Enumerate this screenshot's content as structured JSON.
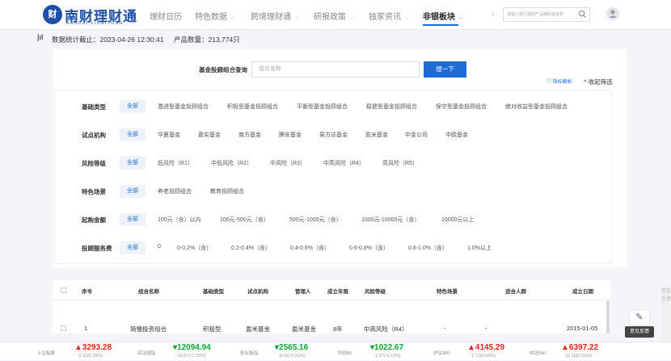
{
  "header": {
    "logo_glyph": "财",
    "brand": "南财理财通",
    "brand_sub": "NANCAI LICAITONG",
    "nav": [
      {
        "label": "理财日历",
        "chevron": false
      },
      {
        "label": "特色数据",
        "chevron": true
      },
      {
        "label": "跨境理财通",
        "chevron": true
      },
      {
        "label": "研报政策",
        "chevron": true
      },
      {
        "label": "独家资讯",
        "chevron": true
      },
      {
        "label": "非银板块",
        "chevron": true,
        "active": true
      }
    ],
    "nav_more_icon": "chevron-right-icon",
    "search_placeholder": "请输入银行理财产品编码或名称",
    "search_icon": "search-icon",
    "user_icon": "avatar-icon"
  },
  "stats": {
    "icon": "bar-chart-icon",
    "time_text": "数据统计截止：2023-04-26 12:30:41",
    "count_text": "产品数量：213,774只"
  },
  "query": {
    "label": "基金投顾组合查询",
    "placeholder": "组合名称",
    "button": "搜一下",
    "help_label": "指标解析",
    "collapse_label": "收起筛选"
  },
  "filters": [
    {
      "name": "基础类型",
      "all": "全部",
      "options": [
        "激进型基金投顾组合",
        "积极型基金投顾组合",
        "平衡型基金投顾组合",
        "稳健型基金投顾组合",
        "保守型基金投顾组合",
        "绝对收益型基金投顾组合"
      ]
    },
    {
      "name": "试点机构",
      "all": "全部",
      "options": [
        "华夏基金",
        "嘉实基金",
        "南方基金",
        "腾安基金",
        "易方达基金",
        "盈米基金",
        "中金公司",
        "中欧基金"
      ]
    },
    {
      "name": "风险等级",
      "all": "全部",
      "options": [
        "低风险（R1）",
        "中低风险（R2）",
        "中风险（R3）",
        "中高风险（R4）",
        "高风险（R5）"
      ]
    },
    {
      "name": "特色场景",
      "all": "全部",
      "options": [
        "养老投顾组合",
        "教育投顾组合"
      ]
    },
    {
      "name": "起购金额",
      "all": "全部",
      "options": [
        "100元（含）以内",
        "100元-500元（含）",
        "500元-1000元（含）",
        "1000元-10000元（含）",
        "10000元以上"
      ]
    },
    {
      "name": "投顾服务费",
      "all": "全部",
      "options": [
        "0",
        "0-0.2%（含）",
        "0.2-0.4%（含）",
        "0.4-0.6%（含）",
        "0.6-0.8%（含）",
        "0.8-1.0%（含）",
        "1.0%以上"
      ]
    }
  ],
  "table": {
    "headers": [
      "序号",
      "组合名称",
      "基础类型",
      "试点机构",
      "管理人",
      "成立年限",
      "风险等级",
      "特色场景",
      "适合人群",
      "成立日期"
    ],
    "rows": [
      [
        "1",
        "简慢投资组合",
        "积极型",
        "盈米基金",
        "盈米基金",
        "8年",
        "中高风险（R4）",
        "-",
        "-",
        "2015-01-05"
      ]
    ]
  },
  "feedback": {
    "icon": "edit-icon",
    "label": "意见反馈"
  },
  "side_tab": "意见反馈",
  "ticker": [
    {
      "name": "上证指数",
      "value": "3293.28",
      "change": "9.12(0.28%)",
      "dir": "up"
    },
    {
      "name": "深证成指",
      "value": "12094.94",
      "change": "-18.67(-0.15%)",
      "dir": "down"
    },
    {
      "name": "创业板指",
      "value": "2565.16",
      "change": "-8.02(-0.31%)",
      "dir": "down"
    },
    {
      "name": "科创50",
      "value": "1022.67",
      "change": "-1.37(-0.13%)",
      "dir": "down"
    },
    {
      "name": "沪深300",
      "value": "4145.29",
      "change": "1.72(0.04%)",
      "dir": "up"
    },
    {
      "name": "中证500",
      "value": "6397.22",
      "change": "13.39(0.21%)",
      "dir": "up"
    }
  ],
  "colors": {
    "brand": "#1e4fa8",
    "accent": "#1e6bd6",
    "up": "#e1251b",
    "down": "#12a23a"
  }
}
